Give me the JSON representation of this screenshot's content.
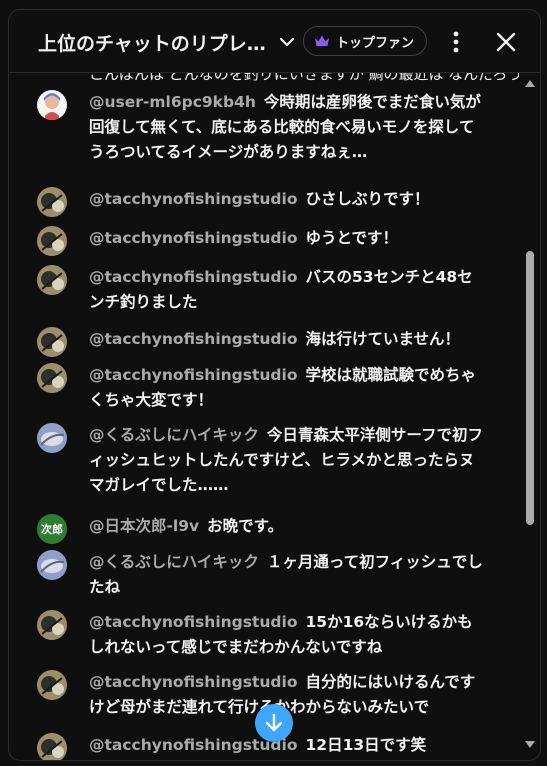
{
  "header": {
    "title": "上位のチャットのリプレ…",
    "fan_chip_label": "トップファン"
  },
  "feed": {
    "cut_line": "こんばんは どんなのを釣りにいきますか 鯛の最近は なんだろう",
    "messages": [
      {
        "author": "@user-ml6pc9kb4h",
        "text": "今時期は産卵後でまだ食い気が回復して無くて、底にある比較的食べ易いモノを探してうろついてるイメージがありますねぇ…",
        "avatar": "character"
      },
      {
        "author": "@tacchynofishingstudio",
        "text": "ひさしぶりです！",
        "avatar": "photo"
      },
      {
        "author": "@tacchynofishingstudio",
        "text": "ゆうとです！",
        "avatar": "photo"
      },
      {
        "author": "@tacchynofishingstudio",
        "text": "バスの53センチと48センチ釣りました",
        "avatar": "photo"
      },
      {
        "author": "@tacchynofishingstudio",
        "text": "海は行けていません！",
        "avatar": "photo"
      },
      {
        "author": "@tacchynofishingstudio",
        "text": "学校は就職試験でめちゃくちゃ大変です！",
        "avatar": "photo"
      },
      {
        "author": "@くるぶしにハイキック",
        "text": "今日青森太平洋側サーフで初フィッシュヒットしたんですけど、ヒラメかと思ったらヌマガレイでした……",
        "avatar": "blue"
      },
      {
        "author": "@日本次郎-l9v",
        "text": "お晩です。",
        "avatar": "green",
        "avatar_label": "次郎"
      },
      {
        "author": "@くるぶしにハイキック",
        "text": "１ヶ月通って初フィッシュでしたね",
        "avatar": "blue"
      },
      {
        "author": "@tacchynofishingstudio",
        "text": "15か16ならいけるかもしれないって感じでまだわかんないですね",
        "avatar": "photo"
      },
      {
        "author": "@tacchynofishingstudio",
        "text": "自分的にはいけるんですけど母がまだ連れて行けるかわからないみたいで",
        "avatar": "photo"
      },
      {
        "author": "@tacchynofishingstudio",
        "text": "12日13日です笑",
        "avatar": "photo"
      }
    ]
  },
  "colors": {
    "background": "#0f0f0f",
    "author": "#aaaaaa",
    "text": "#f1f1f1",
    "accent": "#3ea6ff",
    "crown": "#8b5cf6",
    "jiro_avatar": "#2e7d32"
  },
  "icons": [
    "chevron-down-icon",
    "crown-icon",
    "more-vert-icon",
    "close-icon",
    "arrow-down-icon"
  ]
}
